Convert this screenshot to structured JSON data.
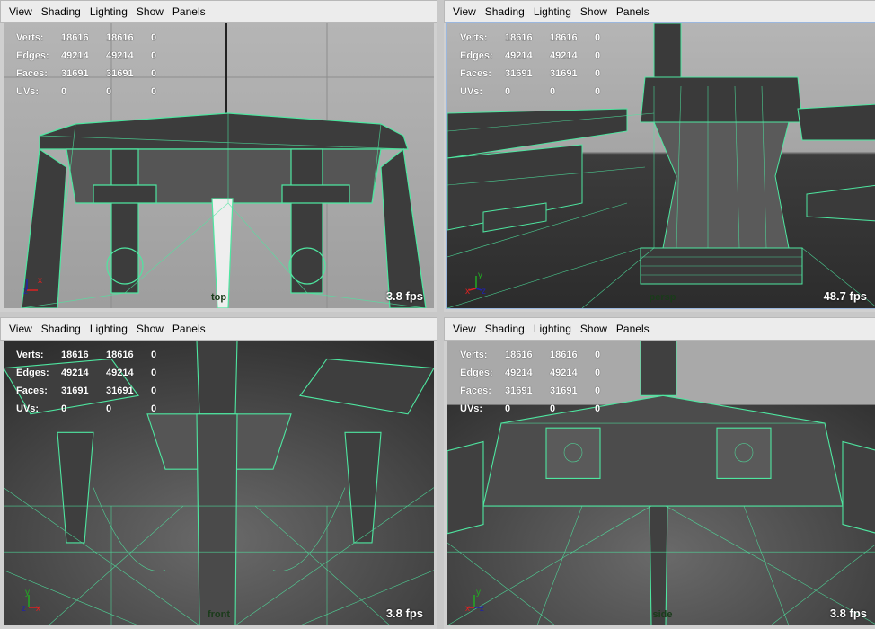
{
  "menus": [
    "View",
    "Shading",
    "Lighting",
    "Show",
    "Panels"
  ],
  "hud": {
    "rows": [
      {
        "label": "Verts:",
        "a": "18616",
        "b": "18616",
        "c": "0"
      },
      {
        "label": "Edges:",
        "a": "49214",
        "b": "49214",
        "c": "0"
      },
      {
        "label": "Faces:",
        "a": "31691",
        "b": "31691",
        "c": "0"
      },
      {
        "label": "UVs:",
        "a": "0",
        "b": "0",
        "c": "0"
      }
    ]
  },
  "panels": [
    {
      "id": "top",
      "camera": "top",
      "fps": "3.8 fps",
      "active": false,
      "axis_labels": [
        "z",
        "x"
      ]
    },
    {
      "id": "persp",
      "camera": "persp",
      "fps": "48.7 fps",
      "active": true,
      "axis_labels": [
        "y",
        "x",
        "z"
      ]
    },
    {
      "id": "front",
      "camera": "front",
      "fps": "3.8 fps",
      "active": false,
      "axis_labels": [
        "y",
        "z",
        "x"
      ]
    },
    {
      "id": "side",
      "camera": "side",
      "fps": "3.8 fps",
      "active": false,
      "axis_labels": [
        "y",
        "x",
        "z"
      ]
    }
  ],
  "colors": {
    "wire": "#4ee6a0",
    "bg_light": "#a9a9a9",
    "bg_dark": "#3a3a3a",
    "mesh": "#4a4a4a"
  }
}
